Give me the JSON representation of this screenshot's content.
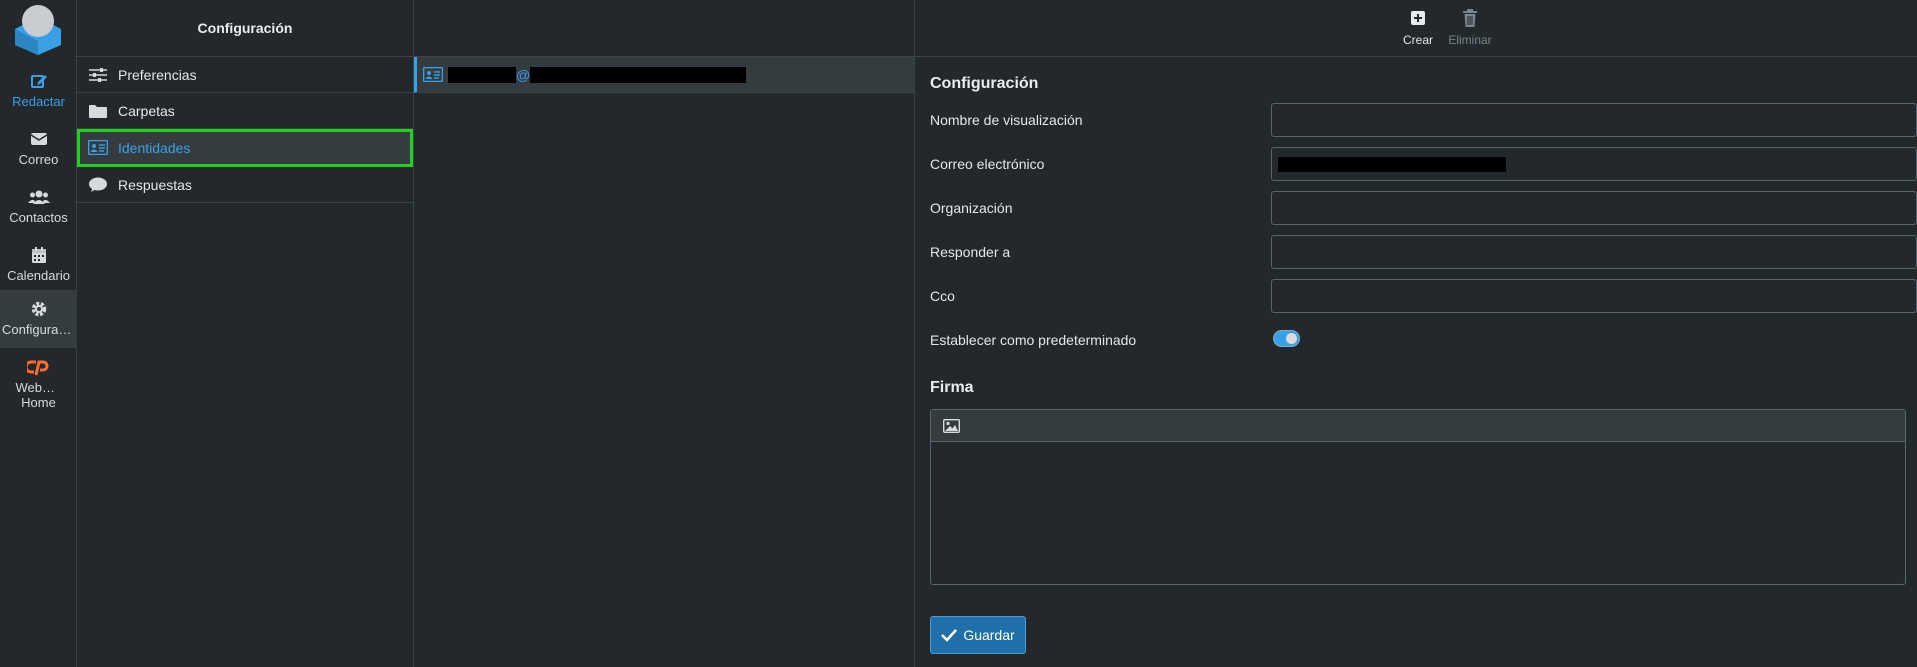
{
  "nav": {
    "items": [
      {
        "label": "Redactar",
        "icon": "compose-icon"
      },
      {
        "label": "Correo",
        "icon": "envelope-icon"
      },
      {
        "label": "Contactos",
        "icon": "users-icon"
      },
      {
        "label": "Calendario",
        "icon": "calendar-icon"
      },
      {
        "label": "Configuraci…",
        "icon": "gear-icon"
      },
      {
        "label": "Webmail Home",
        "icon": "cpanel-icon"
      }
    ],
    "accent": "#3aa0e6",
    "cpanel_color": "#ff6c2c"
  },
  "settings": {
    "title": "Configuración",
    "items": [
      {
        "label": "Preferencias",
        "icon": "sliders-icon"
      },
      {
        "label": "Carpetas",
        "icon": "folder-icon"
      },
      {
        "label": "Identidades",
        "icon": "id-card-icon"
      },
      {
        "label": "Respuestas",
        "icon": "comment-icon"
      }
    ],
    "highlight_color": "#22d11d"
  },
  "identities": {
    "row": {
      "at": "@"
    }
  },
  "toolbar": {
    "create_label": "Crear",
    "delete_label": "Eliminar"
  },
  "form": {
    "section_title": "Configuración",
    "fields": {
      "display_name_label": "Nombre de visualización",
      "display_name_value": "",
      "email_label": "Correo electrónico",
      "organization_label": "Organización",
      "organization_value": "",
      "reply_to_label": "Responder a",
      "reply_to_value": "",
      "bcc_label": "Cco",
      "bcc_value": "",
      "default_label": "Establecer como predeterminado",
      "default_enabled": true
    },
    "signature_title": "Firma",
    "save_label": "Guardar"
  }
}
